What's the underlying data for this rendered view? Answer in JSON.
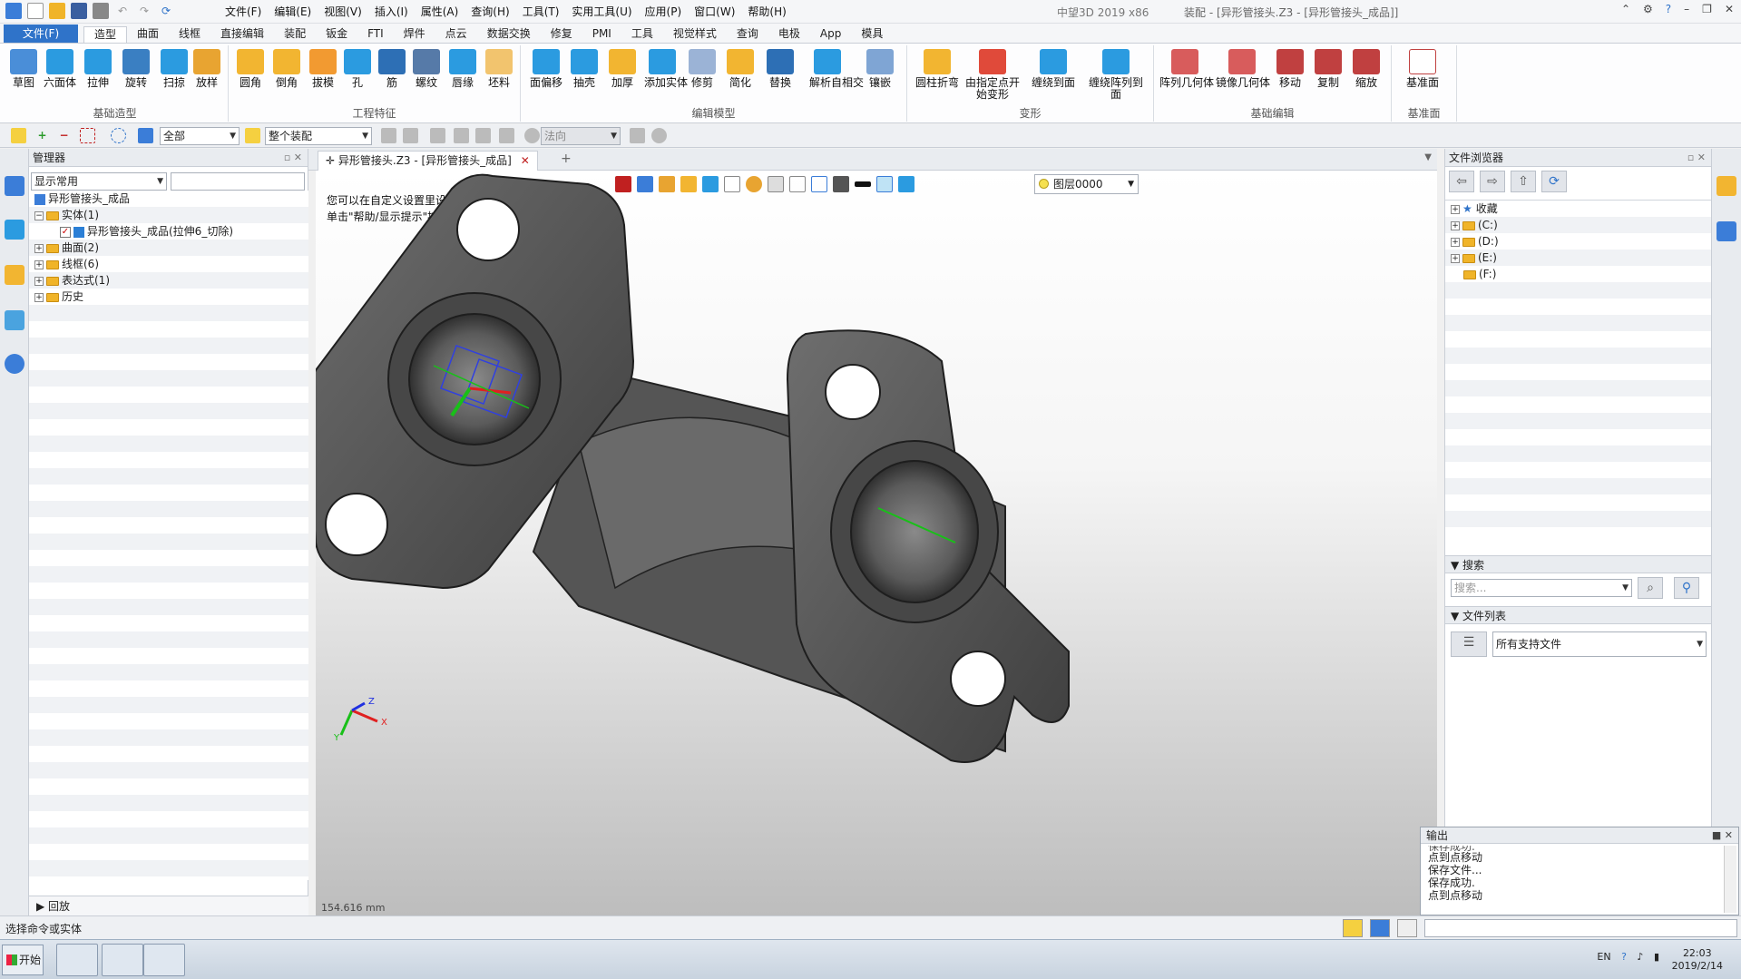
{
  "title_bar": {
    "menu": [
      "文件(F)",
      "编辑(E)",
      "视图(V)",
      "插入(I)",
      "属性(A)",
      "查询(H)",
      "工具(T)",
      "实用工具(U)",
      "应用(P)",
      "窗口(W)",
      "帮助(H)"
    ],
    "app_name": "中望3D 2019 x86",
    "doc_title": "装配 - [异形管接头.Z3 - [异形管接头_成品]]"
  },
  "ribbon_tabs": {
    "file": "文件(F)",
    "tabs": [
      "造型",
      "曲面",
      "线框",
      "直接编辑",
      "装配",
      "钣金",
      "FTI",
      "焊件",
      "点云",
      "数据交换",
      "修复",
      "PMI",
      "工具",
      "视觉样式",
      "查询",
      "电极",
      "App",
      "模具"
    ],
    "active": "造型"
  },
  "ribbon_groups": [
    {
      "label": "基础造型",
      "buttons": [
        "草图",
        "六面体",
        "拉伸",
        "旋转",
        "扫掠",
        "放样"
      ]
    },
    {
      "label": "工程特征",
      "buttons": [
        "圆角",
        "倒角",
        "拔模",
        "孔",
        "筋",
        "螺纹",
        "唇缘",
        "坯料"
      ]
    },
    {
      "label": "编辑模型",
      "buttons": [
        "面偏移",
        "抽壳",
        "加厚",
        "添加实体",
        "修剪",
        "简化",
        "替换",
        "解析自相交",
        "镶嵌"
      ]
    },
    {
      "label": "变形",
      "buttons": [
        "圆柱折弯",
        "由指定点开始变形",
        "缠绕到面",
        "缠绕阵列到面"
      ]
    },
    {
      "label": "基础编辑",
      "buttons": [
        "阵列几何体",
        "镜像几何体",
        "移动",
        "复制",
        "缩放"
      ]
    },
    {
      "label": "基准面",
      "buttons": [
        "基准面"
      ]
    }
  ],
  "toolbar2": {
    "filter_value": "全部",
    "assembly_value": "整个装配",
    "direction_value": "法向"
  },
  "manager": {
    "title": "管理器",
    "filter_value": "显示常用",
    "tree": [
      {
        "label": "异形管接头_成品",
        "level": 0
      },
      {
        "label": "实体(1)",
        "level": 1
      },
      {
        "label": "异形管接头_成品(拉伸6_切除)",
        "level": 2
      },
      {
        "label": "曲面(2)",
        "level": 1
      },
      {
        "label": "线框(6)",
        "level": 1
      },
      {
        "label": "表达式(1)",
        "level": 1
      },
      {
        "label": "历史",
        "level": 1
      }
    ],
    "replay_label": "回放"
  },
  "viewport": {
    "doc_tab": "异形管接头.Z3 - [异形管接头_成品]",
    "layer": "图层0000",
    "hint_line1": "您可以在自定义设置里设置热键",
    "hint_line2": "单击\"帮助/显示提示\"按钮来取消这些提示.",
    "scale": "154.616 mm",
    "axis_x": "X",
    "axis_y": "Y",
    "axis_z": "Z"
  },
  "browser": {
    "title": "文件浏览器",
    "tree": [
      "收藏",
      "(C:)",
      "(D:)",
      "(E:)",
      "(F:)"
    ],
    "search_section": "搜索",
    "search_placeholder": "搜索...",
    "filelist_section": "文件列表",
    "filetype_value": "所有支持文件"
  },
  "output": {
    "title": "输出",
    "lines": [
      "保存成功.",
      "点到点移动",
      "保存文件...",
      "保存成功.",
      "点到点移动"
    ]
  },
  "status": {
    "text": "选择命令或实体"
  },
  "taskbar": {
    "start": "开始",
    "lang": "EN",
    "time": "22:03",
    "date": "2019/2/14"
  },
  "colors": {
    "accent": "#2f73c9",
    "model_gray": "#5a5a5a",
    "folder": "#f0b429"
  }
}
